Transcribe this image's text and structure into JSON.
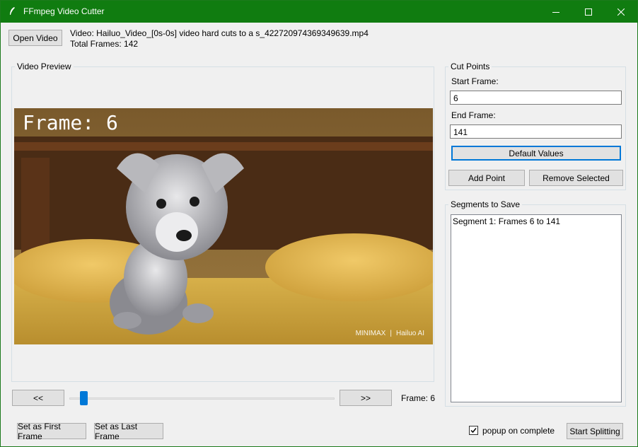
{
  "window": {
    "title": "FFmpeg Video Cutter"
  },
  "toolbar": {
    "open_label": "Open Video",
    "video_info": "Video: Hailuo_Video_[0s-0s] video hard cuts to a s_422720974369349639.mp4",
    "total_frames": "Total Frames: 142"
  },
  "preview": {
    "group_label": "Video Preview",
    "overlay_text": "Frame: 6",
    "watermark_left": "MINIMAX",
    "watermark_right": "Hailuo AI"
  },
  "navigation": {
    "prev_label": "<<",
    "next_label": ">>",
    "frame_label": "Frame: 6",
    "slider_value": 6,
    "slider_max": 141
  },
  "cut_points": {
    "group_label": "Cut Points",
    "start_label": "Start Frame:",
    "start_value": "6",
    "end_label": "End Frame:",
    "end_value": "141",
    "default_label": "Default Values",
    "add_label": "Add Point",
    "remove_label": "Remove Selected"
  },
  "segments": {
    "group_label": "Segments to Save",
    "items": [
      "Segment 1: Frames 6 to 141"
    ]
  },
  "bottom": {
    "first_label": "Set as First Frame",
    "last_label": "Set as Last Frame",
    "popup_label": "popup on complete",
    "popup_checked": true,
    "split_label": "Start Splitting"
  },
  "colors": {
    "titlebar": "#107c10",
    "accent": "#0078d7"
  }
}
